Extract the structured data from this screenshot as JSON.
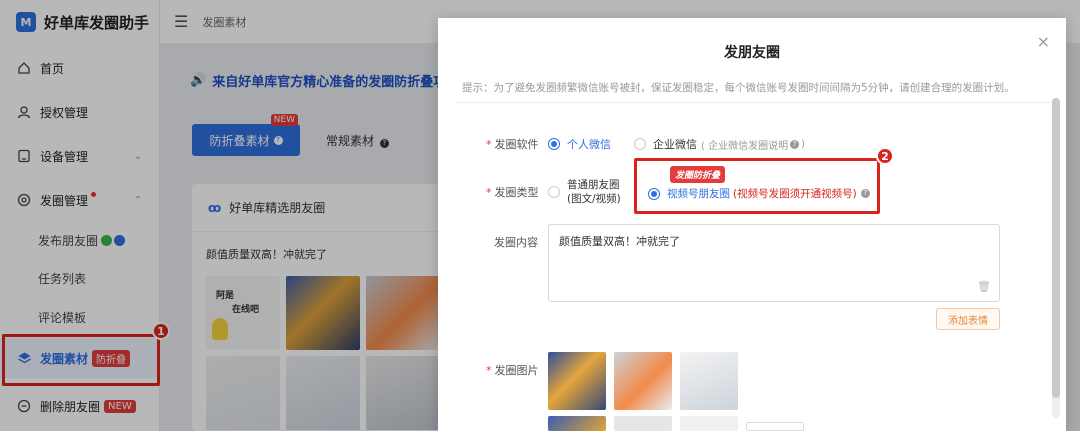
{
  "app": {
    "logo_mark": "M",
    "name": "好单库发圈助手"
  },
  "topbar": {
    "breadcrumb": "发圈素材"
  },
  "sidebar": {
    "home": "首页",
    "auth": "授权管理",
    "device": "设备管理",
    "circle": "发圈管理",
    "publish": "发布朋友圈",
    "tasks": "任务列表",
    "comments": "评论模板",
    "material": "发圈素材",
    "material_badge": "防折叠",
    "delete": "删除朋友圈",
    "delete_badge": "NEW"
  },
  "annotations": {
    "marker1": "1",
    "marker2": "2"
  },
  "content": {
    "banner": "来自好单库官方精心准备的发圈防折叠攻",
    "tab_primary": "防折叠素材",
    "tab_primary_badge": "NEW",
    "tab_secondary": "常规素材",
    "card_title": "好单库精选朋友圈",
    "post_text": "颜值质量双高！冲就完了",
    "thumb_caption_1": "阿是",
    "thumb_caption_2": "在线吧"
  },
  "modal": {
    "title": "发朋友圈",
    "close": "×",
    "tip": "提示：为了避免发圈频繁微信账号被封，保证发圈稳定，每个微信账号发圈时间间隔为5分钟，请创建合理的发圈计划。",
    "software_label": "发圈软件",
    "software_personal": "个人微信",
    "software_enterprise": "企业微信",
    "software_enterprise_note": "( 企业微信发圈说明",
    "software_enterprise_note_end": ")",
    "type_label": "发圈类型",
    "type_normal_line1": "普通朋友圈",
    "type_normal_line2": "(图文/视频)",
    "type_video_tag": "发圈防折叠",
    "type_video": "视频号朋友圈",
    "type_video_note": "(视频号发圈须开通视频号)",
    "content_label": "发圈内容",
    "content_value": "颜值质量双高！冲就完了",
    "emoji_button": "添加表情",
    "images_label": "发圈图片"
  },
  "colors": {
    "primary": "#2f6fe0",
    "highlight": "#d9231d",
    "badge": "#e23c3c"
  }
}
